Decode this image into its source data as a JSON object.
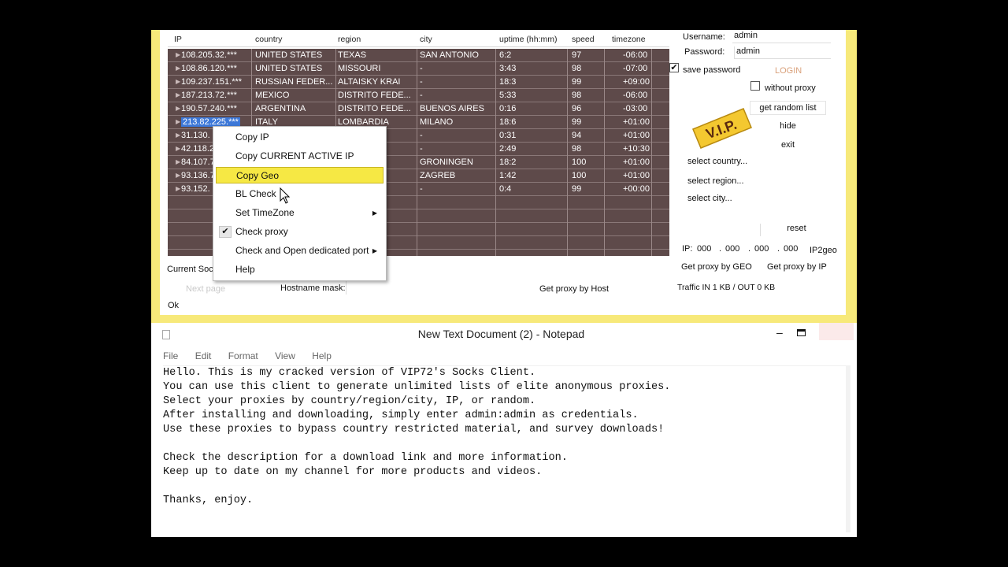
{
  "socks_client": {
    "table": {
      "columns": [
        "IP",
        "country",
        "region",
        "city",
        "uptime (hh:mm)",
        "speed",
        "timezone"
      ],
      "rows": [
        {
          "ip": "108.205.32.***",
          "country": "UNITED STATES",
          "region": "TEXAS",
          "city": "SAN ANTONIO",
          "uptime": "6:2",
          "speed": "97",
          "timezone": "-06:00"
        },
        {
          "ip": "108.86.120.***",
          "country": "UNITED STATES",
          "region": "MISSOURI",
          "city": "-",
          "uptime": "3:43",
          "speed": "98",
          "timezone": "-07:00"
        },
        {
          "ip": "109.237.151.***",
          "country": "RUSSIAN FEDER...",
          "region": "ALTAISKY KRAI",
          "city": "-",
          "uptime": "18:3",
          "speed": "99",
          "timezone": "+09:00"
        },
        {
          "ip": "187.213.72.***",
          "country": "MEXICO",
          "region": "DISTRITO FEDE...",
          "city": "-",
          "uptime": "5:33",
          "speed": "98",
          "timezone": "-06:00"
        },
        {
          "ip": "190.57.240.***",
          "country": "ARGENTINA",
          "region": "DISTRITO FEDE...",
          "city": "BUENOS AIRES",
          "uptime": "0:16",
          "speed": "96",
          "timezone": "-03:00"
        },
        {
          "ip": "213.82.225.***",
          "country": "ITALY",
          "region": "LOMBARDIA",
          "city": "MILANO",
          "uptime": "18:6",
          "speed": "99",
          "timezone": "+01:00"
        },
        {
          "ip": "31.130.",
          "country": "",
          "region": "",
          "city": "-",
          "uptime": "0:31",
          "speed": "94",
          "timezone": "+01:00"
        },
        {
          "ip": "42.118.2",
          "country": "",
          "region": "H",
          "city": "-",
          "uptime": "2:49",
          "speed": "98",
          "timezone": "+10:30"
        },
        {
          "ip": "84.107.7",
          "country": "",
          "region": "",
          "city": "GRONINGEN",
          "uptime": "18:2",
          "speed": "100",
          "timezone": "+01:00"
        },
        {
          "ip": "93.136.7",
          "country": "",
          "region": "EB",
          "city": "ZAGREB",
          "uptime": "1:42",
          "speed": "100",
          "timezone": "+01:00"
        },
        {
          "ip": "93.152.",
          "country": "",
          "region": "",
          "city": "-",
          "uptime": "0:4",
          "speed": "99",
          "timezone": "+00:00"
        }
      ]
    },
    "current_socks_label": "Current Soc",
    "next_page_label": "Next page",
    "hostname_mask_label": "Hostname mask:",
    "get_proxy_by_host_label": "Get proxy by Host",
    "status_text": "Ok",
    "side": {
      "username_label": "Username:",
      "username_value": "admin",
      "password_label": "Password:",
      "password_value": "admin",
      "save_password_label": "save password",
      "login_label": "LOGIN",
      "without_proxy_label": "without proxy",
      "get_random_list_label": "get random list",
      "hide_label": "hide",
      "exit_label": "exit",
      "logo_text": "V.I.P.",
      "select_country_label": "select country...",
      "select_region_label": "select region...",
      "select_city_label": "select city...",
      "reset_label": "reset",
      "ip_label": "IP:",
      "ip_octets": [
        "000",
        "000",
        "000",
        "000"
      ],
      "ip2geo_label": "IP2geo",
      "get_proxy_by_geo_label": "Get proxy by GEO",
      "get_proxy_by_ip_label": "Get proxy by IP",
      "traffic_text": "Traffic IN 1 KB / OUT 0 KB"
    }
  },
  "context_menu": {
    "items": [
      {
        "label": "Copy IP"
      },
      {
        "label": "Copy CURRENT ACTIVE IP"
      },
      {
        "label": "Copy Geo"
      },
      {
        "label": "BL Check"
      },
      {
        "label": "Set TimeZone"
      },
      {
        "label": "Check proxy"
      },
      {
        "label": "Check and Open dedicated port"
      },
      {
        "label": "Help"
      }
    ]
  },
  "notepad": {
    "title": "New Text Document (2) - Notepad",
    "menu": [
      "File",
      "Edit",
      "Format",
      "View",
      "Help"
    ],
    "lines": [
      "Hello. This is my cracked version of VIP72's Socks Client.",
      "You can use this client to generate unlimited lists of elite anonymous proxies.",
      "Select your proxies by country/region/city, IP, or random.",
      "After installing and downloading, simply enter admin:admin as credentials.",
      "Use these proxies to bypass country restricted material, and survey downloads!",
      "",
      "Check the description for a download link and more information.",
      "Keep up to date on my channel for more products and videos.",
      "",
      "Thanks, enjoy."
    ]
  },
  "colors": {
    "window_border": "#f7e97a",
    "table_bg": "#5e4a4a",
    "menu_highlight": "#f6e844",
    "selection_blue": "#3d78d8"
  }
}
